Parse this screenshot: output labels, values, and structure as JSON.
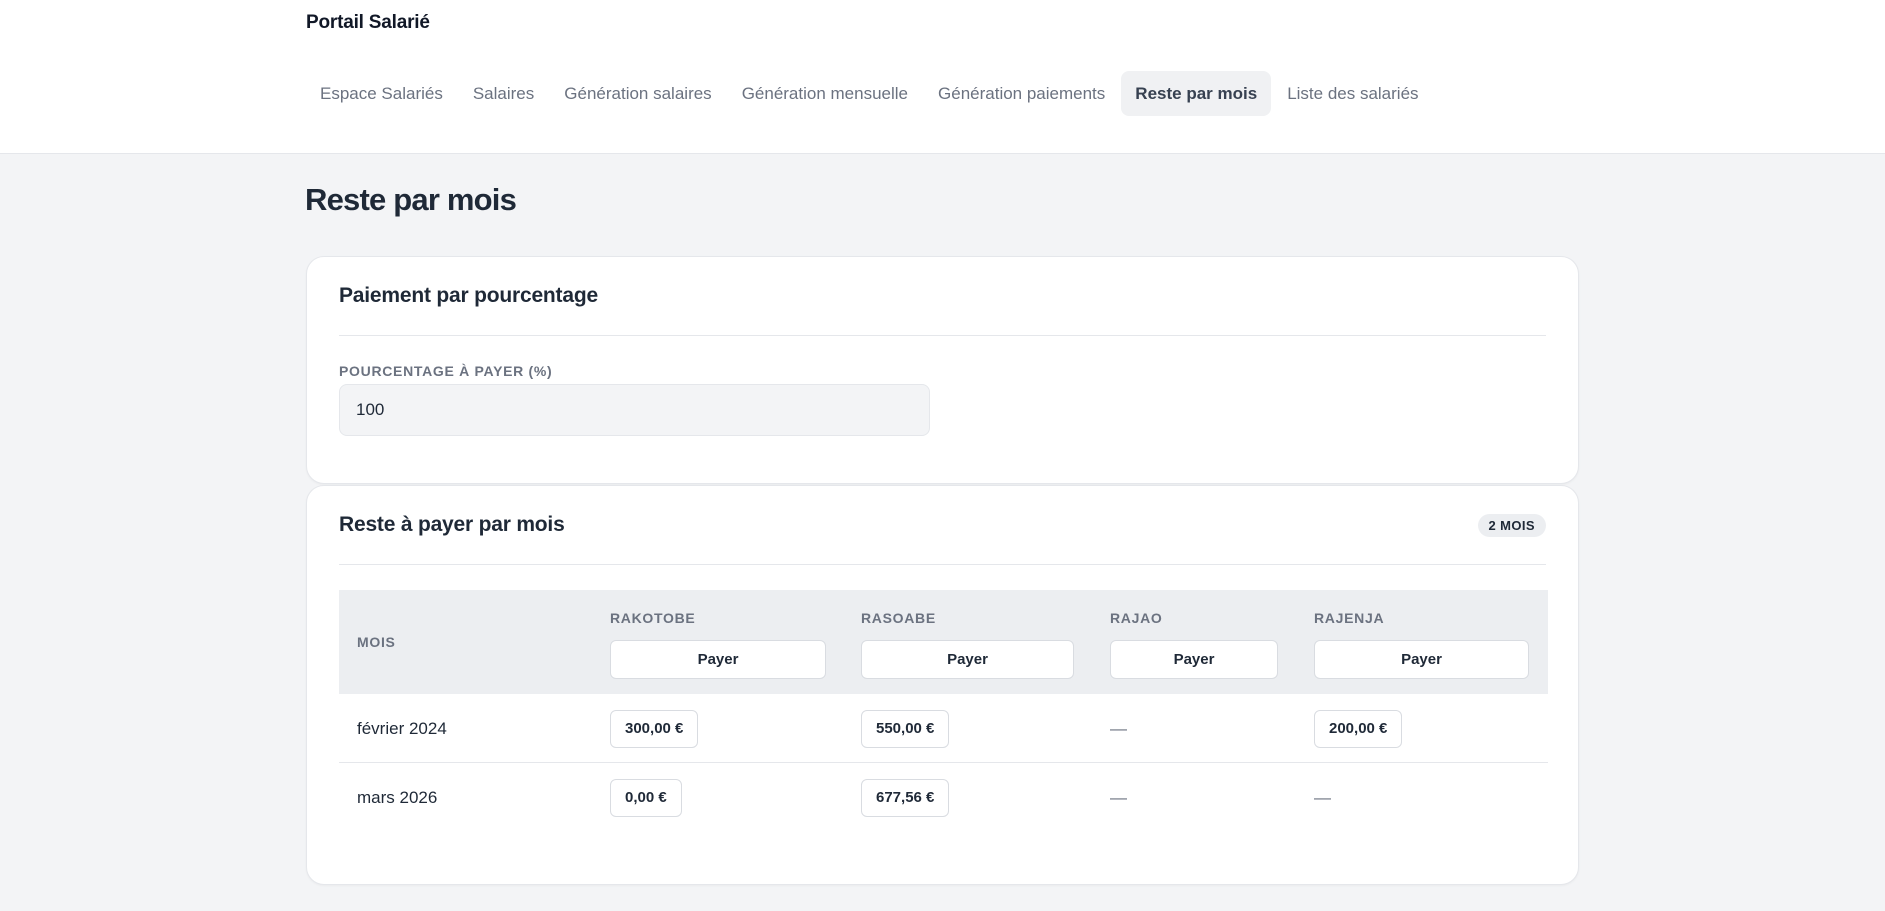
{
  "header": {
    "brand": "Portail Salarié",
    "nav": [
      {
        "label": "Espace Salariés",
        "active": false
      },
      {
        "label": "Salaires",
        "active": false
      },
      {
        "label": "Génération salaires",
        "active": false
      },
      {
        "label": "Génération mensuelle",
        "active": false
      },
      {
        "label": "Génération paiements",
        "active": false
      },
      {
        "label": "Reste par mois",
        "active": true
      },
      {
        "label": "Liste des salariés",
        "active": false
      }
    ]
  },
  "page": {
    "title": "Reste par mois"
  },
  "percentage_card": {
    "title": "Paiement par pourcentage",
    "field_label": "POURCENTAGE À PAYER (%)",
    "field_value": "100"
  },
  "remaining_card": {
    "title": "Reste à payer par mois",
    "badge": "2 MOIS",
    "table": {
      "month_header": "MOIS",
      "pay_label": "Payer",
      "employees": [
        "RAKOTOBE",
        "RASOABE",
        "RAJAO",
        "RAJENJA"
      ],
      "rows": [
        {
          "month": "février 2024",
          "amounts": [
            "300,00 €",
            "550,00 €",
            "—",
            "200,00 €"
          ]
        },
        {
          "month": "mars 2026",
          "amounts": [
            "0,00 €",
            "677,56 €",
            "—",
            "—"
          ]
        }
      ]
    }
  },
  "colors": {
    "page_background": "#f3f4f6",
    "card_background": "#ffffff",
    "table_header_background": "#eceef1",
    "active_nav_background": "#f0f1f3",
    "muted_text": "#6b7280",
    "primary_text": "#1f2937"
  }
}
